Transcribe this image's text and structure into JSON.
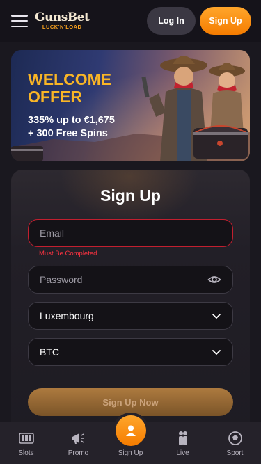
{
  "header": {
    "logo_main": "GunsBet",
    "logo_sub": "LUCK'N'LOAD",
    "login_label": "Log In",
    "signup_label": "Sign Up"
  },
  "banner": {
    "title": "WELCOME OFFER",
    "line1": "335% up to €1,675",
    "line2": "+ 300 Free Spins"
  },
  "form": {
    "title": "Sign Up",
    "email_placeholder": "Email",
    "email_error": "Must Be Completed",
    "password_placeholder": "Password",
    "country_value": "Luxembourg",
    "currency_value": "BTC",
    "submit_label": "Sign Up Now"
  },
  "bottom_nav": [
    {
      "label": "Slots",
      "icon": "slots-icon"
    },
    {
      "label": "Promo",
      "icon": "megaphone-icon"
    },
    {
      "label": "Sign Up",
      "icon": "user-icon"
    },
    {
      "label": "Live",
      "icon": "live-dealer-icon"
    },
    {
      "label": "Sport",
      "icon": "soccer-ball-icon"
    }
  ],
  "colors": {
    "accent": "#f7a11e",
    "error": "#ff3341",
    "background": "#1a181f"
  }
}
